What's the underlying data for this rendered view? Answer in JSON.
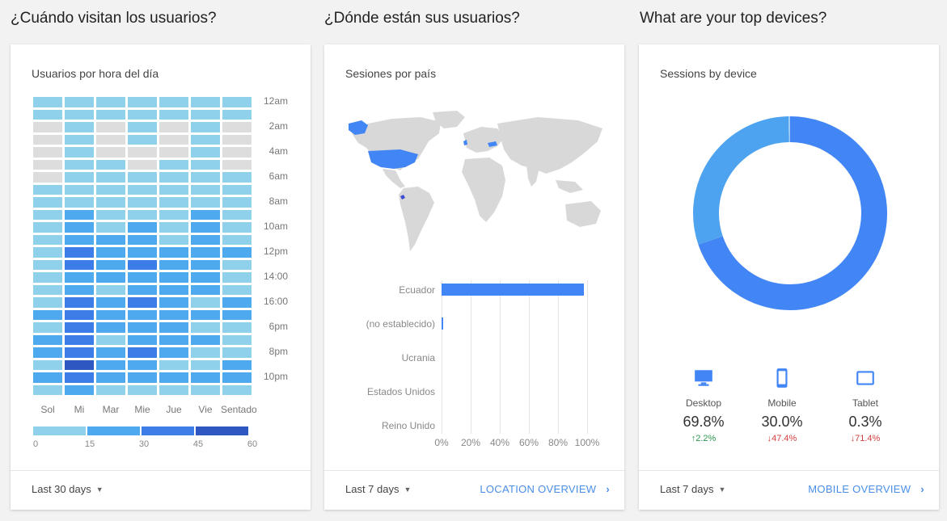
{
  "sections": {
    "when": "¿Cuándo visitan los usuarios?",
    "where": "¿Dónde están sus usuarios?",
    "devices": "What are your top devices?"
  },
  "card1": {
    "title": "Usuarios por hora del día",
    "footer_range": "Last 30 days",
    "hour_labels": [
      "12am",
      "2am",
      "4am",
      "6am",
      "8am",
      "10am",
      "12pm",
      "14:00",
      "16:00",
      "6pm",
      "8pm",
      "10pm"
    ],
    "day_labels": [
      "Sol",
      "Mi",
      "Mar",
      "Mie",
      "Jue",
      "Vie",
      "Sentado"
    ],
    "scale_labels": [
      "0",
      "15",
      "30",
      "45",
      "60"
    ],
    "colors": {
      "empty": "#dddddd",
      "c1": "#8fd0ea",
      "c2": "#4ea9ee",
      "c3": "#3c7de8",
      "c4": "#2f57c2"
    }
  },
  "card2": {
    "title": "Sesiones por país",
    "footer_range": "Last 7 days",
    "link": "LOCATION OVERVIEW",
    "map_colors": {
      "land": "#d8d8d8",
      "highlight": "#4285f4"
    }
  },
  "card3": {
    "title": "Sessions by device",
    "footer_range": "Last 7 days",
    "link": "MOBILE OVERVIEW",
    "devices": [
      {
        "name": "Desktop",
        "pct": "69.8%",
        "change": "↑2.2%",
        "dir": "up",
        "icon": "desktop-icon"
      },
      {
        "name": "Mobile",
        "pct": "30.0%",
        "change": "↓47.4%",
        "dir": "down",
        "icon": "mobile-icon"
      },
      {
        "name": "Tablet",
        "pct": "0.3%",
        "change": "↓71.4%",
        "dir": "down",
        "icon": "tablet-icon"
      }
    ],
    "colors": {
      "desktop": "#4285f4",
      "mobile": "#4ea3f0",
      "tablet": "#9ecbf5"
    }
  },
  "chart_data": [
    {
      "type": "heatmap",
      "title": "Usuarios por hora del día",
      "x": [
        "Sol",
        "Mi",
        "Mar",
        "Mie",
        "Jue",
        "Vie",
        "Sentado"
      ],
      "y": [
        "12am",
        "1am",
        "2am",
        "3am",
        "4am",
        "5am",
        "6am",
        "7am",
        "8am",
        "9am",
        "10am",
        "11am",
        "12pm",
        "1pm",
        "14:00",
        "3pm",
        "16:00",
        "5pm",
        "6pm",
        "7pm",
        "8pm",
        "9pm",
        "10pm",
        "11pm"
      ],
      "values": [
        [
          15,
          15,
          15,
          15,
          15,
          15,
          15
        ],
        [
          15,
          15,
          15,
          15,
          15,
          15,
          15
        ],
        [
          0,
          15,
          0,
          15,
          0,
          15,
          0
        ],
        [
          0,
          15,
          0,
          15,
          0,
          15,
          0
        ],
        [
          0,
          15,
          0,
          0,
          0,
          15,
          0
        ],
        [
          0,
          15,
          15,
          0,
          15,
          15,
          0
        ],
        [
          0,
          15,
          15,
          15,
          15,
          15,
          15
        ],
        [
          15,
          15,
          15,
          15,
          15,
          15,
          15
        ],
        [
          15,
          15,
          15,
          15,
          15,
          15,
          15
        ],
        [
          15,
          30,
          15,
          15,
          15,
          30,
          15
        ],
        [
          15,
          30,
          15,
          30,
          15,
          30,
          15
        ],
        [
          15,
          30,
          30,
          30,
          15,
          30,
          15
        ],
        [
          15,
          45,
          30,
          30,
          30,
          30,
          30
        ],
        [
          15,
          45,
          30,
          45,
          30,
          30,
          15
        ],
        [
          15,
          30,
          30,
          30,
          30,
          30,
          15
        ],
        [
          15,
          30,
          15,
          30,
          30,
          30,
          15
        ],
        [
          15,
          45,
          30,
          45,
          30,
          15,
          30
        ],
        [
          30,
          45,
          30,
          30,
          30,
          30,
          30
        ],
        [
          15,
          45,
          30,
          30,
          30,
          15,
          15
        ],
        [
          30,
          45,
          15,
          30,
          30,
          30,
          15
        ],
        [
          30,
          45,
          30,
          45,
          30,
          15,
          15
        ],
        [
          15,
          60,
          30,
          30,
          15,
          15,
          30
        ],
        [
          30,
          45,
          30,
          30,
          30,
          30,
          30
        ],
        [
          15,
          30,
          15,
          15,
          15,
          15,
          15
        ]
      ],
      "scale": [
        0,
        15,
        30,
        45,
        60
      ]
    },
    {
      "type": "bar",
      "title": "Sesiones por país",
      "categories": [
        "Ecuador",
        "(no establecido)",
        "Ucrania",
        "Estados Unidos",
        "Reino Unido"
      ],
      "values": [
        98,
        1,
        0,
        0,
        0
      ],
      "xlim": [
        0,
        100
      ],
      "xticks": [
        "0%",
        "20%",
        "40%",
        "60%",
        "80%",
        "100%"
      ]
    },
    {
      "type": "pie",
      "title": "Sessions by device",
      "categories": [
        "Desktop",
        "Mobile",
        "Tablet"
      ],
      "values": [
        69.8,
        30.0,
        0.3
      ]
    }
  ]
}
